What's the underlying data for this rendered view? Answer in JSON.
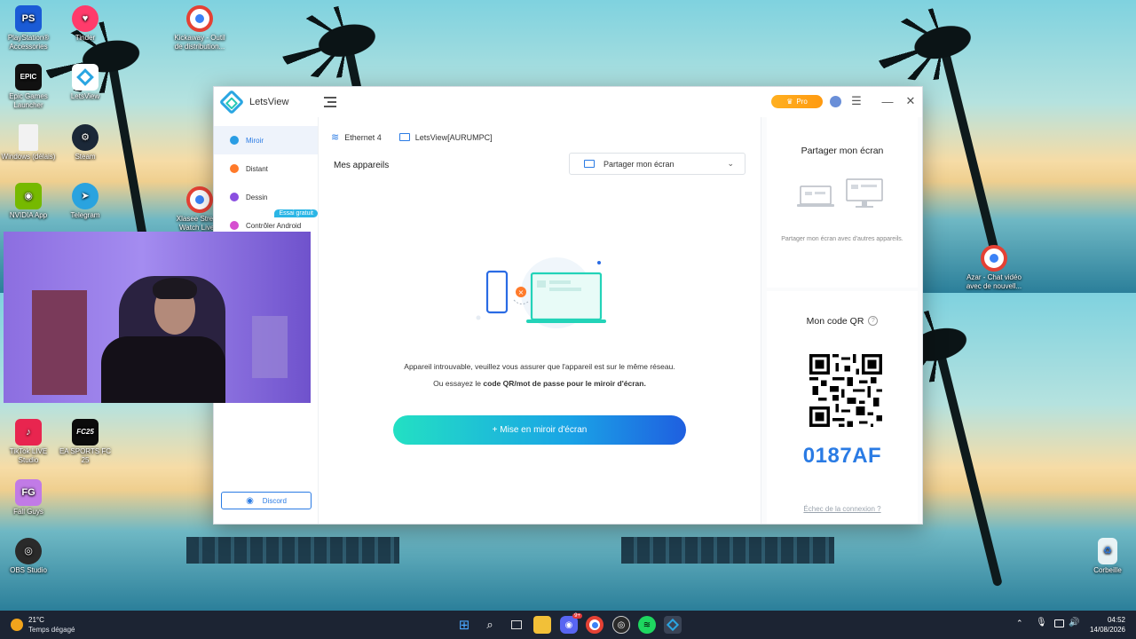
{
  "desktop": {
    "icons": [
      {
        "label": "PlayStation® Accessories",
        "icon": "playstation-icon",
        "color": "#1a5bd6"
      },
      {
        "label": "Tinder",
        "icon": "tinder-icon",
        "color": "#ff3b6b"
      },
      {
        "label": "Kickaway - Outil de distribution...",
        "icon": "chrome-icon",
        "color": "#ffffff"
      },
      {
        "label": "Epic Games Launcher",
        "icon": "epic-games-icon",
        "color": "#111111"
      },
      {
        "label": "LetsView",
        "icon": "letsview-icon",
        "color": "#ffffff"
      },
      {
        "label": "Windows (délais)",
        "icon": "file-icon",
        "color": "#f2f2f2"
      },
      {
        "label": "Steam",
        "icon": "steam-icon",
        "color": "#1b2838"
      },
      {
        "label": "NVIDIA App",
        "icon": "nvidia-icon",
        "color": "#76b900"
      },
      {
        "label": "Telegram",
        "icon": "telegram-icon",
        "color": "#2aa3df"
      },
      {
        "label": "Xlasee Stream Watch Live...",
        "icon": "chrome-icon",
        "color": "#ffffff"
      },
      {
        "label": "Azar - Chat vidéo avec de nouvell...",
        "icon": "chrome-icon",
        "color": "#ffffff"
      },
      {
        "label": "TikTok LIVE Studio",
        "icon": "tiktok-icon",
        "color": "#e8254f"
      },
      {
        "label": "EA SPORTS FC 25",
        "icon": "ea-fc-icon",
        "color": "#0b0b0b"
      },
      {
        "label": "Fall Guys",
        "icon": "fall-guys-icon",
        "color": "#c17be6"
      },
      {
        "label": "OBS Studio",
        "icon": "obs-icon",
        "color": "#2a2a2a"
      },
      {
        "label": "Corbeille",
        "icon": "recycle-bin-icon",
        "color": "#ffffff"
      }
    ]
  },
  "app": {
    "title": "LetsView",
    "pro_label": "Pro",
    "sidebar": {
      "items": [
        {
          "label": "Miroir",
          "color": "#2a9de4"
        },
        {
          "label": "Distant",
          "color": "#ff7a2a"
        },
        {
          "label": "Dessin",
          "color": "#8a4fe0"
        },
        {
          "label": "Contrôler Android",
          "color": "#d64fd0"
        }
      ],
      "badge": "Essai gratuit",
      "discord_label": "Discord"
    },
    "main": {
      "network_label": "Ethernet 4",
      "device_label": "LetsView[AURUMPC]",
      "devices_title": "Mes appareils",
      "share_select_value": "Partager mon écran",
      "message_line1": "Appareil introuvable, veuillez vous assurer que l'appareil est sur le même réseau.",
      "message_line2_prefix": "Ou essayez le ",
      "message_line2_bold": "code QR/mot de passe pour le miroir d'écran.",
      "mirror_button": "+ Mise en miroir d'écran"
    },
    "right_panel": {
      "share_title": "Partager mon écran",
      "share_desc": "Partager mon écran avec d'autres appareils.",
      "qr_title": "Mon code QR",
      "code": "0187AF",
      "fail_link": "Échec de la connexion ?"
    }
  },
  "taskbar": {
    "weather_temp": "21°C",
    "weather_condition": "Temps dégagé",
    "time": "04:52",
    "date": "14/08/2026",
    "discord_badge": "9+"
  },
  "colors": {
    "accent": "#2a7be4",
    "pro": "#ffa615",
    "taskbar": "#1c2433"
  }
}
